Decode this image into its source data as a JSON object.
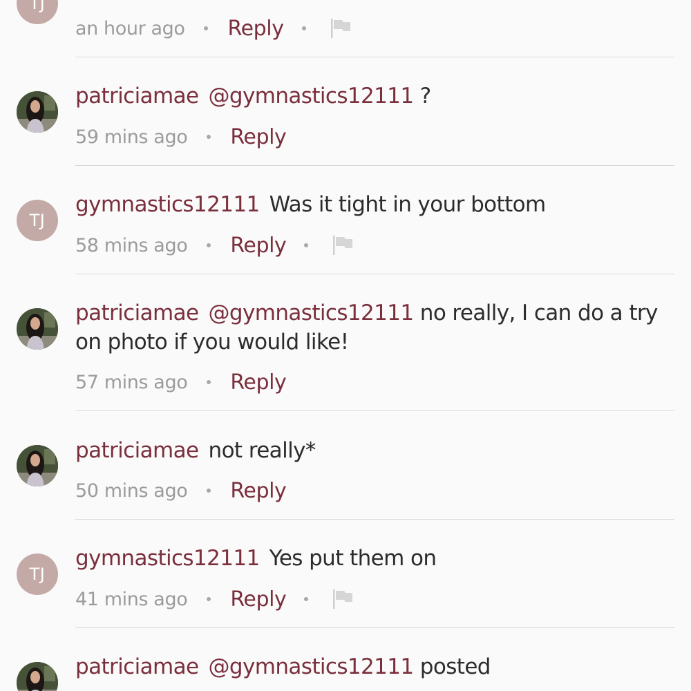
{
  "colors": {
    "background": "#fbfafb",
    "username": "#7a2f3c",
    "text": "#2c2c2c",
    "timestamp": "#9b9b9b",
    "avatar_initials_bg": "#c4aaa6",
    "divider": "#d8d8d8"
  },
  "icons": {
    "flag": "flag-icon",
    "separator": "dot-separator"
  },
  "comments": [
    {
      "avatar_initials": "TJ",
      "time": "an hour ago",
      "reply": "Reply",
      "flaggable": true
    },
    {
      "user": "patriciamae",
      "mention": "@gymnastics12111",
      "text": " ?",
      "time": "59 mins ago",
      "reply": "Reply"
    },
    {
      "user": "gymnastics12111",
      "avatar_initials": "TJ",
      "text": "Was it tight in your bottom",
      "time": "58 mins ago",
      "reply": "Reply",
      "flaggable": true
    },
    {
      "user": "patriciamae",
      "mention": "@gymnastics12111",
      "text": " no really, I can do a try on photo if you would like!",
      "time": "57 mins ago",
      "reply": "Reply"
    },
    {
      "user": "patriciamae",
      "text": "not really*",
      "time": "50 mins ago",
      "reply": "Reply"
    },
    {
      "user": "gymnastics12111",
      "avatar_initials": "TJ",
      "text": "Yes put them on",
      "time": "41 mins ago",
      "reply": "Reply",
      "flaggable": true
    },
    {
      "user": "patriciamae",
      "mention": "@gymnastics12111",
      "text": " posted"
    }
  ]
}
